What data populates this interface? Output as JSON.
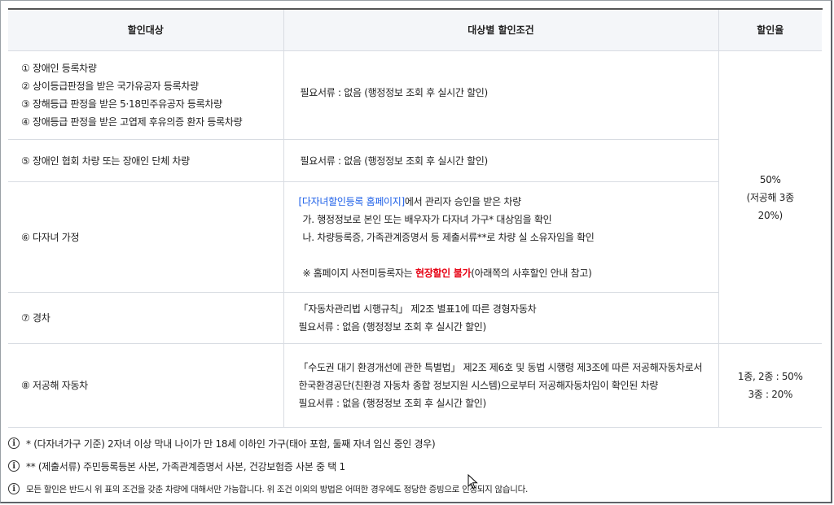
{
  "table": {
    "headers": [
      "할인대상",
      "대상별 할인조건",
      "할인율"
    ],
    "rows": [
      {
        "target_lines": [
          "① 장애인 등록차량",
          "② 상이등급판정을 받은 국가유공자 등록차량",
          "③ 장해등급 판정을 받은 5·18민주유공자 등록차량",
          "④ 장애등급 판정을 받은 고엽제 후유의증 환자 등록차량"
        ],
        "condition_lines": [
          "필요서류 : 없음 (행정정보 조회 후 실시간 할인)"
        ]
      },
      {
        "target": "⑤ 장애인 협회 차량 또는 장애인 단체 차량",
        "condition_lines": [
          "필요서류 : 없음 (행정정보 조회 후 실시간 할인)"
        ]
      },
      {
        "target": "⑥ 다자녀 가정",
        "link_text": "[다자녀할인등록 홈페이지]",
        "link_suffix": "에서 관리자 승인을 받은 차량",
        "condition_lines": [
          "가. 행정정보로 본인 또는 배우자가 다자녀 가구* 대상임을 확인",
          "나. 차량등록증, 가족관계증명서 등 제출서류**로 차량 실 소유자임을 확인"
        ],
        "warning_prefix": "※ 홈페이지 사전미등록자는 ",
        "warning_red": "현장할인 불가",
        "warning_suffix": "(아래쪽의 사후할인 안내 참고)"
      },
      {
        "target": "⑦ 경차",
        "condition_lines": [
          "「자동차관리법 시행규칙」 제2조 별표1에 따른 경형자동차",
          "필요서류 : 없음 (행정정보 조회 후 실시간 할인)"
        ]
      },
      {
        "target": "⑧ 저공해 자동차",
        "condition_paragraph": "「수도권 대기 환경개선에 관한 특별법」 제2조 제6호 및 동법 시행령 제3조에 따른 저공해자동차로서 한국환경공단(친환경 자동차 종합 정보지원 시스템)으로부터 저공해자동차임이 확인된 차량",
        "condition_lines": [
          "필요서류 : 없음 (행정정보 조회 후 실시간 할인)"
        ]
      }
    ],
    "rate_group": [
      "50%",
      "(저공해 3종",
      "20%)"
    ],
    "rate_low_emission": [
      "1종, 2종 : 50%",
      "3종 : 20%"
    ]
  },
  "notes": [
    "* (다자녀가구 기준) 2자녀 이상 막내 나이가 만 18세 이하인 가구(태아 포함, 둘째 자녀 임신 중인 경우)",
    "** (제출서류) 주민등록등본 사본, 가족관계증명서 사본, 건강보험증 사본 중 택 1",
    "모든 할인은 반드시 위 표의 조건을 갖춘 차량에 대해서만 가능합니다. 위 조건 이외의 방법은 어떠한 경우에도 정당한 증빙으로 인정되지 않습니다."
  ],
  "icons": {
    "info": "info-circle-icon",
    "cursor": "mouse-pointer-icon"
  },
  "colors": {
    "link": "#1b5ee8",
    "warning": "#e60012",
    "header_bg": "#f4f6f9"
  }
}
